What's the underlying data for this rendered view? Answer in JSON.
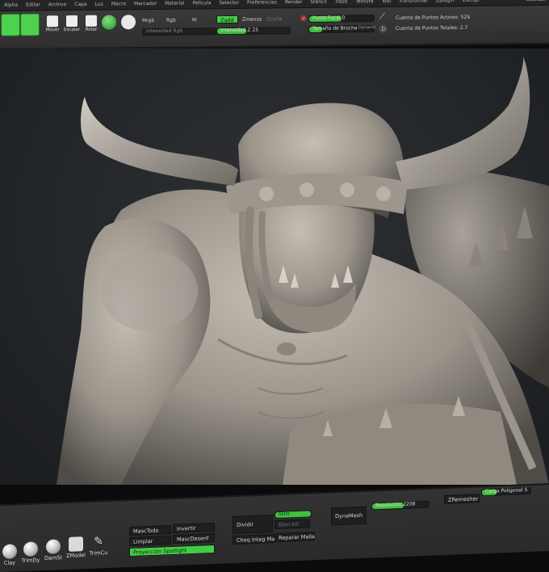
{
  "menu": [
    "Alpha",
    "Editar",
    "Archivo",
    "Capa",
    "Luz",
    "Macro",
    "Marcador",
    "Material",
    "Película",
    "Selector",
    "Preferencias",
    "Render",
    "Stencil",
    "Trazo",
    "Textura",
    "Tool",
    "Transformar",
    "Zplugin",
    "Zscript"
  ],
  "menu_right": "Guardar",
  "shelf": {
    "tools": [
      "Mover",
      "Escalar",
      "Rotar"
    ],
    "mrgb": "Mrgb",
    "rgb": "Rgb",
    "m": "M",
    "zadd": "Zadd",
    "zsub": "Zmenos",
    "zcut": "Zcorte",
    "rgb_intensity": "Intensidad Rgb",
    "z_intensity": "Intensidad Z 25",
    "focal": "Punto Focal 0",
    "draw_size": "Tamaño de Brocha",
    "dynamic": "Dynamic",
    "active_points": "Cuenta de Puntos Activos: 529",
    "total_points": "Cuenta de Puntos Totales: 2.7"
  },
  "bottom": {
    "brushes": [
      "Clay",
      "TrimDy",
      "DamSt",
      "ZModel",
      "TrimCu"
    ],
    "mask_all": "MascTodo",
    "invert": "Invertir",
    "clear": "Limpiar",
    "mask_desensitize": "MascDesenf",
    "spotlight": "Proyección Spotlight",
    "divide": "Dividir",
    "sdiv": "SDiv",
    "del_lower": "Elim Inf",
    "check_integrity": "Cheq Integ Ma",
    "fix_mesh": "Reparar Malla",
    "dynamesh": "DynaMesh",
    "resolution": "Resolución 2208",
    "zremesher": "ZRemesher",
    "poly_load": "Carga Poligonal S"
  },
  "colors": {
    "accent": "#3fbf3f",
    "clay": "#a49e96"
  }
}
